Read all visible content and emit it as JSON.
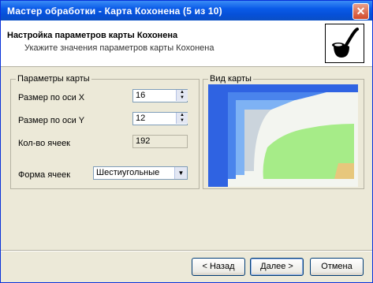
{
  "window": {
    "title": "Мастер обработки - Карта Кохонена (5 из 10)",
    "close_glyph": "✕"
  },
  "header": {
    "title": "Настройка параметров карты Кохонена",
    "subtitle": "Укажите значения параметров карты Кохонена",
    "logo_icon": "pipe-icon"
  },
  "params": {
    "legend": "Параметры карты",
    "size_x_label": "Размер по оси X",
    "size_x_value": "16",
    "size_y_label": "Размер по оси Y",
    "size_y_value": "12",
    "cells_label": "Кол-во ячеек",
    "cells_value": "192",
    "shape_label": "Форма ячеек",
    "shape_value": "Шестиугольные"
  },
  "view": {
    "legend": "Вид карты",
    "colors": [
      "#2f63e2",
      "#4a84ec",
      "#7eb2f4",
      "#cbd4dc",
      "#f3f5f0",
      "#a6ec88",
      "#e7c77c"
    ]
  },
  "footer": {
    "back_label": "< Назад",
    "next_label": "Далее >",
    "cancel_label": "Отмена"
  },
  "accent": "#0a5be8"
}
